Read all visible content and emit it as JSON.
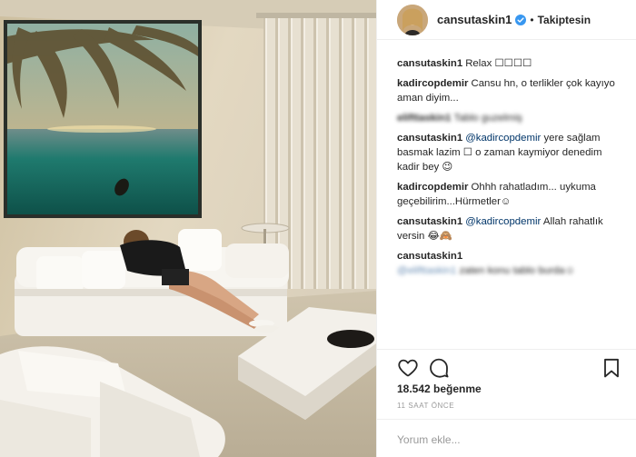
{
  "post": {
    "username": "cansutaskin1",
    "follow_status": "Takiptesin",
    "separator": "•"
  },
  "comments": [
    {
      "username": "cansutaskin1",
      "mention": "",
      "text": "Relax ☐☐☐☐",
      "blurred": false
    },
    {
      "username": "kadircopdemir",
      "mention": "",
      "text": "Cansu hn, o terlikler çok kayıyo aman diyim...",
      "blurred": false
    },
    {
      "username": "elifttaskin1",
      "mention": "",
      "text": "Tablo guzelmiş",
      "blurred": true
    },
    {
      "username": "cansutaskin1",
      "mention": "@kadircopdemir",
      "text": "yere sağlam basmak lazim ☐ o zaman kaymiyor denedim kadir bey 😉",
      "blurred": false
    },
    {
      "username": "kadircopdemir",
      "mention": "",
      "text": "Ohhh rahatladım... uykuma geçebilirim...Hürmetler☺",
      "blurred": false
    },
    {
      "username": "cansutaskin1",
      "mention": "@kadircopdemir",
      "text": "Allah rahatlık versin 😂🙈",
      "blurred": false
    },
    {
      "username": "cansutaskin1",
      "mention": "@elifttaskin1",
      "text": "zaten konu tablo burda☺",
      "blurred": true
    }
  ],
  "actions": {
    "likes": "18.542 beğenme",
    "time_ago": "11 SAAT ÖNCE",
    "comment_placeholder": "Yorum ekle..."
  },
  "colors": {
    "text": "#262626",
    "mention": "#003569",
    "muted": "#999999",
    "verified": "#3897f0",
    "divider": "#efefef"
  },
  "icons": [
    "verified-badge-icon",
    "heart-icon",
    "comment-icon",
    "bookmark-icon"
  ]
}
